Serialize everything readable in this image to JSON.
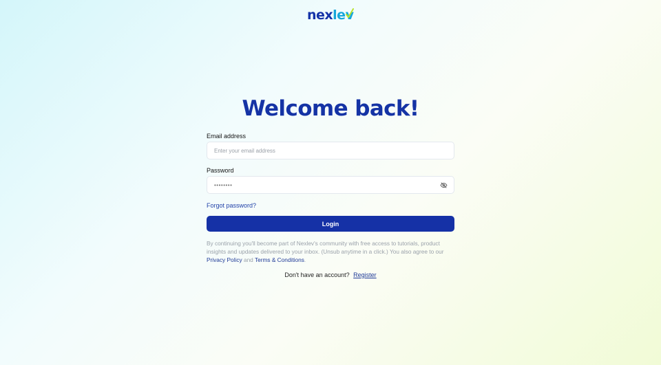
{
  "logo": {
    "part1": "nex",
    "part2": "lev",
    "icon": "leaf-check-icon"
  },
  "page_title": "Welcome back!",
  "email": {
    "label": "Email address",
    "placeholder": "Enter your email address",
    "value": ""
  },
  "password": {
    "label": "Password",
    "masked_value": "••••••••",
    "toggle_icon": "eye-off-icon"
  },
  "forgot_password": "Forgot password?",
  "login_button": "Login",
  "legal": {
    "text": "By continuing you'll become part of Nexlev's community with free access to tutorials, product insights and updates delivered to your inbox. (Unsub anytime in a click.) You also agree to our",
    "privacy": "Privacy Policy",
    "and": "and",
    "terms": "Terms & Conditions",
    "end": "."
  },
  "register": {
    "prompt": "Don't have an account?",
    "link": "Register"
  },
  "colors": {
    "brand_navy": "#1533a5",
    "brand_cyan": "#17a7d9",
    "brand_lime": "#b8e22c"
  }
}
